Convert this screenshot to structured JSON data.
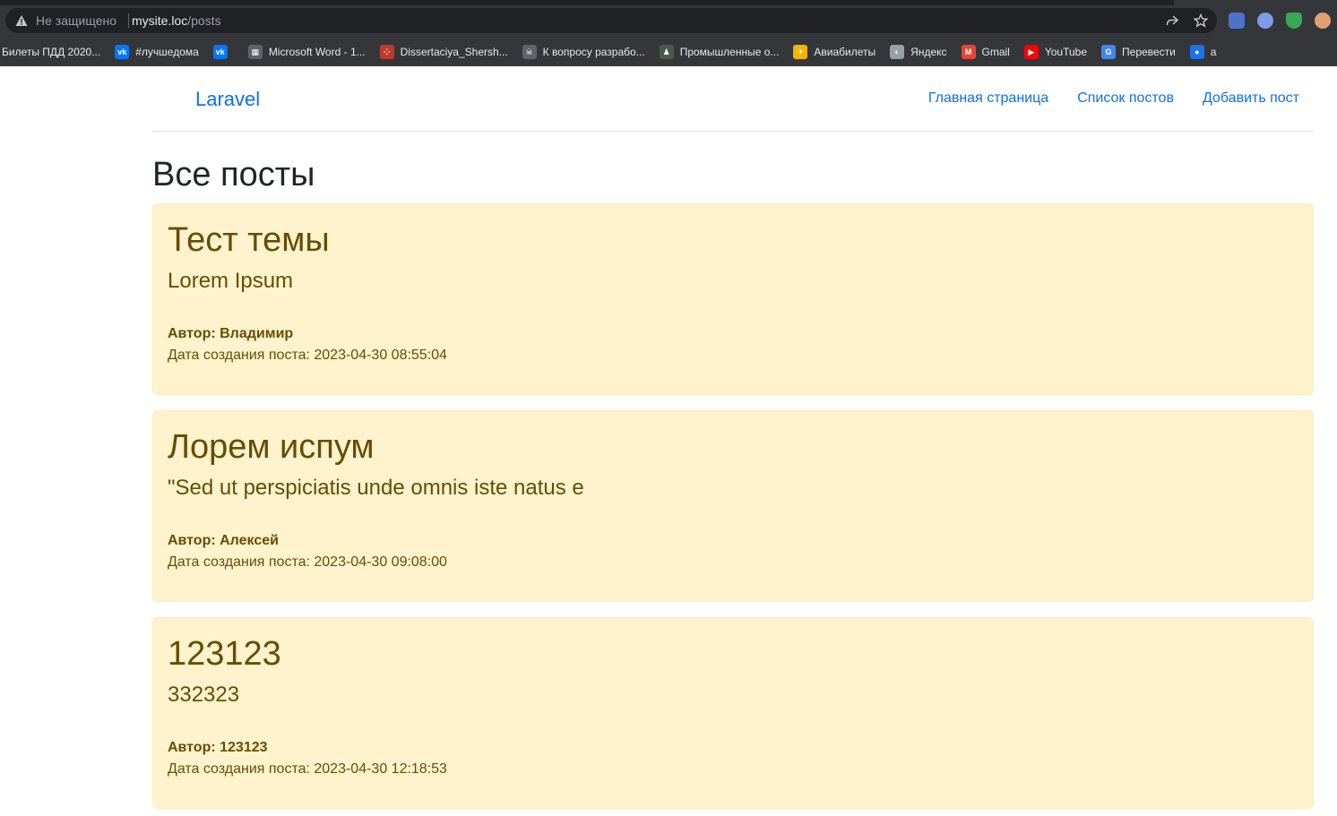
{
  "browser": {
    "security_label": "Не защищено",
    "url_host": "mysite.loc",
    "url_path": "/posts",
    "bookmarks": [
      {
        "label": "Билеты ПДД 2020...",
        "icon": "generic-icon",
        "color": "#35363a"
      },
      {
        "label": "#лучшедома",
        "icon": "vk-icon",
        "color": "#0077ff"
      },
      {
        "label": "",
        "icon": "vk-icon",
        "color": "#0077ff"
      },
      {
        "label": "Microsoft Word - 1...",
        "icon": "document-icon",
        "color": "#5f6368"
      },
      {
        "label": "Dissertaciya_Shersh...",
        "icon": "dots-icon",
        "color": "#c0392b"
      },
      {
        "label": "К вопросу разрабо...",
        "icon": "skull-icon",
        "color": "#5f6368"
      },
      {
        "label": "Промышленные о...",
        "icon": "person-icon",
        "color": "#4a5a4a"
      },
      {
        "label": "Авиабилеты",
        "icon": "plane-icon",
        "color": "#f4b400"
      },
      {
        "label": "Яндекс",
        "icon": "globe-icon",
        "color": "#9aa0a6"
      },
      {
        "label": "Gmail",
        "icon": "gmail-icon",
        "color": "#ea4335"
      },
      {
        "label": "YouTube",
        "icon": "youtube-icon",
        "color": "#ff0000"
      },
      {
        "label": "Перевести",
        "icon": "translate-icon",
        "color": "#4285f4"
      },
      {
        "label": "a",
        "icon": "chat-icon",
        "color": "#1a73e8"
      }
    ]
  },
  "navbar": {
    "brand": "Laravel",
    "links": [
      "Главная страница",
      "Список постов",
      "Добавить пост"
    ]
  },
  "page_title": "Все посты",
  "posts": [
    {
      "title": "Тест темы",
      "body": "Lorem Ipsum",
      "author": "Автор: Владимир",
      "date": "Дата создания поста: 2023-04-30 08:55:04"
    },
    {
      "title": "Лорем испум",
      "body": "\"Sed ut perspiciatis unde omnis iste natus e",
      "author": "Автор: Алексей",
      "date": "Дата создания поста: 2023-04-30 09:08:00"
    },
    {
      "title": "123123",
      "body": "332323",
      "author": "Автор: 123123",
      "date": "Дата создания поста: 2023-04-30 12:18:53"
    }
  ],
  "colors": {
    "alert_bg": "#fff3cd",
    "alert_text": "#664d03",
    "link": "#0d6efd"
  }
}
